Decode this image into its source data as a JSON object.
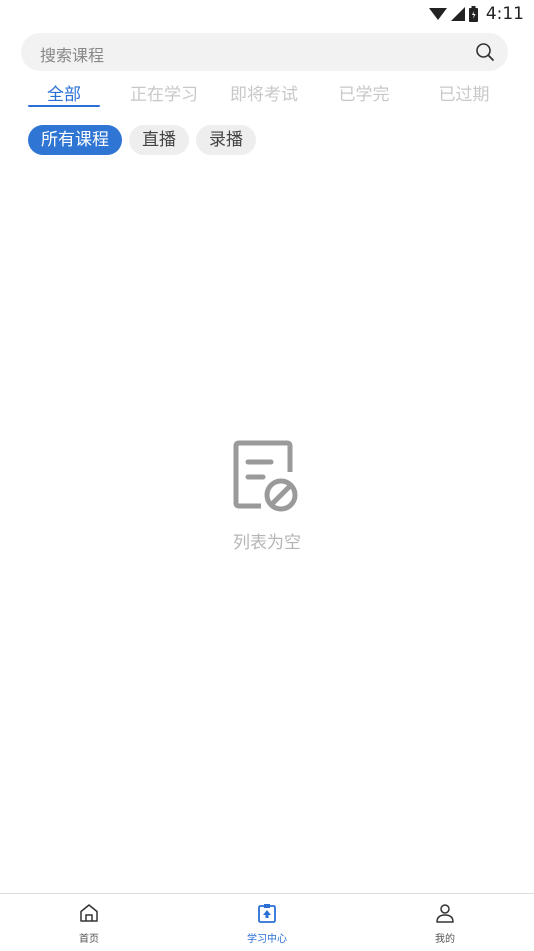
{
  "status_bar": {
    "time": "4:11"
  },
  "search": {
    "placeholder": "搜索课程"
  },
  "tabs": [
    {
      "label": "全部",
      "active": true
    },
    {
      "label": "正在学习",
      "active": false
    },
    {
      "label": "即将考试",
      "active": false
    },
    {
      "label": "已学完",
      "active": false
    },
    {
      "label": "已过期",
      "active": false
    }
  ],
  "chips": [
    {
      "label": "所有课程",
      "active": true
    },
    {
      "label": "直播",
      "active": false
    },
    {
      "label": "录播",
      "active": false
    }
  ],
  "empty_state": {
    "text": "列表为空",
    "icon": "empty-document-icon"
  },
  "bottom_nav": [
    {
      "label": "首页",
      "icon": "home-icon",
      "active": false
    },
    {
      "label": "学习中心",
      "icon": "study-center-icon",
      "active": true
    },
    {
      "label": "我的",
      "icon": "profile-icon",
      "active": false
    }
  ],
  "colors": {
    "accent": "#2a6fd6",
    "inactive_tab": "#c8c8c8"
  }
}
